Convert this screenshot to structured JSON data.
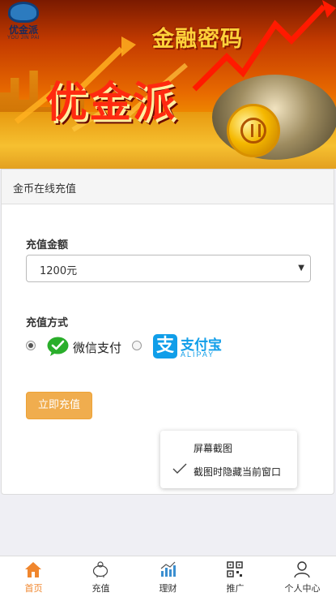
{
  "banner": {
    "logo_name": "优金派",
    "logo_sub": "YOU JIN PAI",
    "tagline": "金融密码",
    "title": "优金派"
  },
  "card": {
    "header": "金币在线充值",
    "amount_label": "充值金额",
    "amount_selected": "1200元",
    "method_label": "充值方式",
    "methods": [
      {
        "name": "微信支付",
        "checked": true
      },
      {
        "name": "支付宝",
        "en": "ALIPAY",
        "checked": false
      }
    ],
    "submit_label": "立即充值"
  },
  "popup": {
    "items": [
      {
        "label": "屏幕截图",
        "checked": false
      },
      {
        "label": "截图时隐藏当前窗口",
        "checked": true
      }
    ]
  },
  "nav": {
    "items": [
      {
        "label": "首页",
        "icon": "home-icon",
        "active": true
      },
      {
        "label": "充值",
        "icon": "piggy-bank-icon",
        "active": false
      },
      {
        "label": "理财",
        "icon": "bar-chart-icon",
        "active": false
      },
      {
        "label": "推广",
        "icon": "qr-code-icon",
        "active": false
      },
      {
        "label": "个人中心",
        "icon": "user-icon",
        "active": false
      }
    ]
  },
  "colors": {
    "accent": "#f0862d",
    "button": "#f0ad4e",
    "wechat": "#2aae2b",
    "alipay": "#109ee9"
  }
}
